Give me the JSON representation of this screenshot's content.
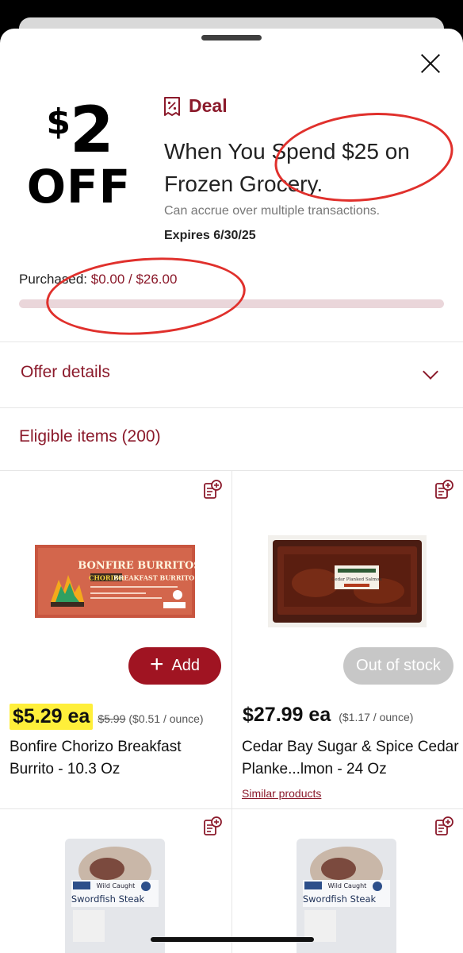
{
  "deal": {
    "badge_amount": "2",
    "badge_dollar": "$",
    "badge_off": "OFF",
    "label": "Deal",
    "headline": "When You Spend $25 on Frozen Grocery.",
    "accrue_note": "Can accrue over multiple transactions.",
    "expires": "Expires 6/30/25",
    "purchased_label": "Purchased:",
    "purchased_value": "$0.00 / $26.00",
    "progress_fraction": 0.0
  },
  "offer_details": {
    "label": "Offer details"
  },
  "eligible": {
    "label": "Eligible items (200)"
  },
  "products": [
    {
      "name": "Bonfire Chorizo Breakfast Burrito - 10.3 Oz",
      "price": "$5.29 ea",
      "was_price": "$5.99",
      "unit_price": "($0.51 / ounce)",
      "button": "Add",
      "image_text": {
        "brand": "BONFIRE BURRITOS",
        "flavor": "CHORIZO",
        "type": "BREAKFAST BURRITO"
      }
    },
    {
      "name": "Cedar Bay Sugar & Spice Cedar Planke...lmon - 24 Oz",
      "price": "$27.99 ea",
      "unit_price": "($1.17 / ounce)",
      "button": "Out of stock",
      "link": "Similar products",
      "image_text": {
        "label": "Cedar Planked Salmon"
      }
    },
    {
      "image_text": {
        "top": "Wild Caught",
        "title": "Swordfish Steak"
      }
    },
    {
      "image_text": {
        "top": "Wild Caught",
        "title": "Swordfish Steak"
      }
    }
  ],
  "colors": {
    "brand": "#8b1a2b",
    "add_button": "#a01422",
    "highlight": "#ffef3a",
    "annotation": "#e0302c"
  }
}
